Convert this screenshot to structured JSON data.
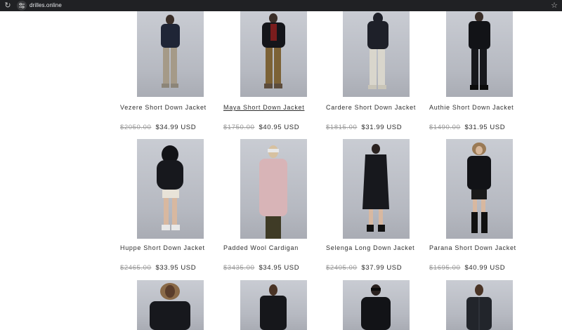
{
  "browser": {
    "url": "drilles.online"
  },
  "products": [
    {
      "name": "Vezere Short Down Jacket",
      "old_price": "$2050.00",
      "new_price": "$34.99 USD"
    },
    {
      "name": "Maya Short Down Jacket",
      "old_price": "$1750.00",
      "new_price": "$40.95 USD"
    },
    {
      "name": "Cardere Short Down Jacket",
      "old_price": "$1815.00",
      "new_price": "$31.99 USD"
    },
    {
      "name": "Authie Short Down Jacket",
      "old_price": "$1490.00",
      "new_price": "$31.95 USD"
    },
    {
      "name": "Huppe Short Down Jacket",
      "old_price": "$2465.00",
      "new_price": "$33.95 USD"
    },
    {
      "name": "Padded Wool Cardigan",
      "old_price": "$3435.00",
      "new_price": "$34.95 USD"
    },
    {
      "name": "Selenga Long Down Jacket",
      "old_price": "$2405.00",
      "new_price": "$37.99 USD"
    },
    {
      "name": "Parana Short Down Jacket",
      "old_price": "$1695.00",
      "new_price": "$40.99 USD"
    }
  ],
  "colors": {
    "chrome_bar": "#202124",
    "photo_background": "#bcc0c7",
    "old_price": "#9a9a9a"
  }
}
